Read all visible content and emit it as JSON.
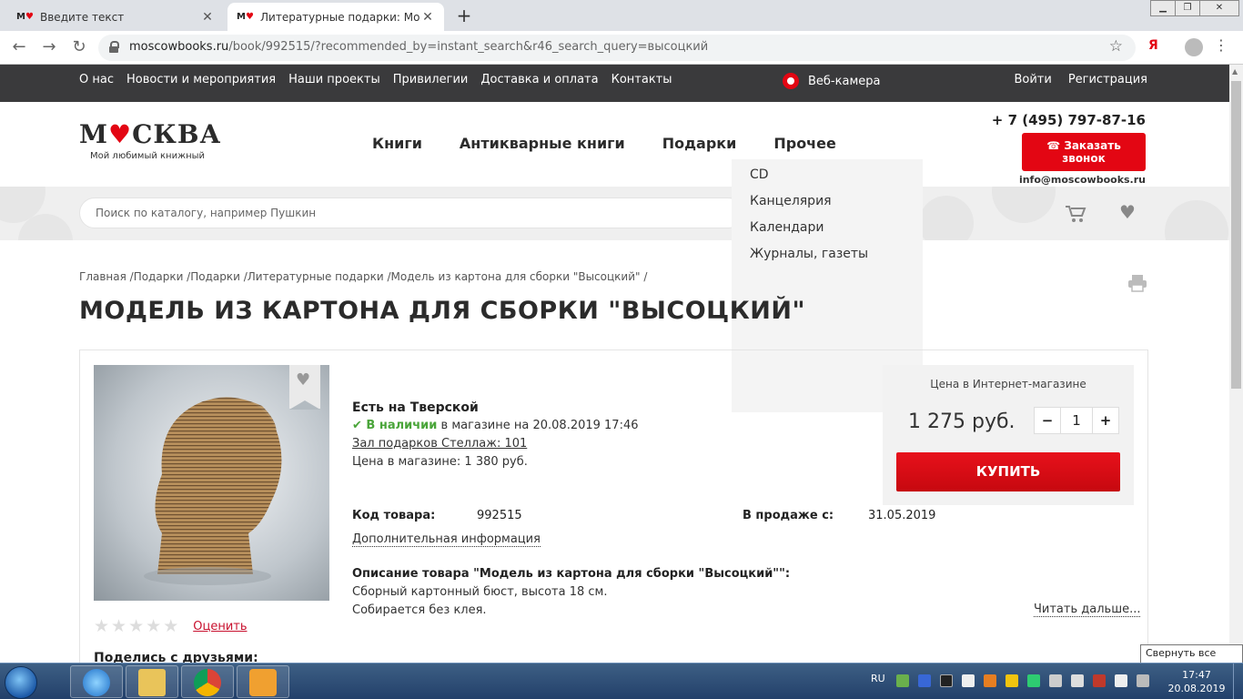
{
  "browser": {
    "tabs": [
      {
        "label": "Введите текст",
        "active": false
      },
      {
        "label": "Литературные подарки: Модел",
        "active": true
      }
    ],
    "favicon_text": "М",
    "url_host": "moscowbooks.ru",
    "url_rest": "/book/992515/?recommended_by=instant_search&r46_search_query=высоцкий",
    "yandex_label": "Я"
  },
  "topbar": {
    "links": [
      "О нас",
      "Новости и мероприятия",
      "Наши проекты",
      "Привилегии",
      "Доставка и оплата",
      "Контакты"
    ],
    "webcam": "Веб-камера",
    "login": "Войти",
    "register": "Регистрация"
  },
  "header": {
    "logo_pre": "М",
    "logo_post": "СКВА",
    "tagline": "Мой любимый книжный",
    "nav": [
      "Книги",
      "Антикварные книги",
      "Подарки",
      "Прочее"
    ],
    "phone": "+ 7 (495) 797-87-16",
    "callback": "Заказать звонок",
    "email": "info@moscowbooks.ru"
  },
  "search": {
    "placeholder": "Поиск по каталогу, например Пушкин"
  },
  "dropdown": [
    "CD",
    "Канцелярия",
    "Календари",
    "Журналы, газеты"
  ],
  "breadcrumb": "Главная /Подарки /Подарки /Литературные подарки /Модель из картона для сборки \"Высоцкий\" /",
  "product": {
    "title": "МОДЕЛЬ ИЗ КАРТОНА ДЛЯ СБОРКИ \"ВЫСОЦКИЙ\"",
    "store": "Есть на Тверской",
    "in_stock": "В наличии",
    "in_stock_rest": " в магазине на 20.08.2019 17:46",
    "location": "Зал подарков Стеллаж: 101",
    "store_price": "Цена в магазине: 1 380 руб.",
    "code_label": "Код товара:",
    "code": "992515",
    "sale_label": "В продаже с:",
    "sale_date": "31.05.2019",
    "extra_info": "Дополнительная информация",
    "desc_title": "Описание товара \"Модель из картона для сборки \"Высоцкий\"\":",
    "desc_line1": "Сборный картонный бюст, высота 18 см.",
    "desc_line2": "Собирается без клея.",
    "read_more": "Читать дальше...",
    "rate": "Оценить",
    "rating": 0,
    "share": "Поделись с друзьями:"
  },
  "price": {
    "label": "Цена в Интернет-магазине",
    "value": "1 275 руб.",
    "qty": "1",
    "minus": "−",
    "plus": "+",
    "buy": "КУПИТЬ"
  },
  "taskbar": {
    "lang": "RU",
    "time": "17:47",
    "date": "20.08.2019",
    "tooltip": "Свернуть все окна"
  },
  "colors": {
    "accent": "#e30613",
    "topbar": "#3a3a3c",
    "in_stock": "#4aa53a"
  }
}
